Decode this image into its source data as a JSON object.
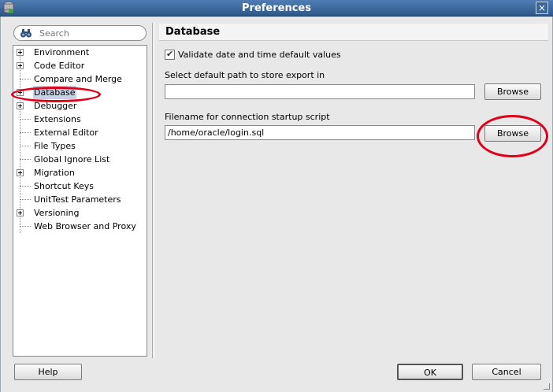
{
  "window": {
    "title": "Preferences",
    "close_glyph": "×",
    "app_icon": "oracle-sqldeveloper-icon"
  },
  "search": {
    "placeholder": "Search",
    "icon": "binoculars-icon"
  },
  "tree": {
    "items": [
      {
        "label": "Environment",
        "expandable": true,
        "selected": false
      },
      {
        "label": "Code Editor",
        "expandable": true,
        "selected": false
      },
      {
        "label": "Compare and Merge",
        "expandable": false,
        "selected": false
      },
      {
        "label": "Database",
        "expandable": true,
        "selected": true
      },
      {
        "label": "Debugger",
        "expandable": true,
        "selected": false
      },
      {
        "label": "Extensions",
        "expandable": false,
        "selected": false
      },
      {
        "label": "External Editor",
        "expandable": false,
        "selected": false
      },
      {
        "label": "File Types",
        "expandable": false,
        "selected": false
      },
      {
        "label": "Global Ignore List",
        "expandable": false,
        "selected": false
      },
      {
        "label": "Migration",
        "expandable": true,
        "selected": false
      },
      {
        "label": "Shortcut Keys",
        "expandable": false,
        "selected": false
      },
      {
        "label": "UnitTest Parameters",
        "expandable": false,
        "selected": false
      },
      {
        "label": "Versioning",
        "expandable": true,
        "selected": false
      },
      {
        "label": "Web Browser and Proxy",
        "expandable": false,
        "selected": false
      }
    ]
  },
  "panel": {
    "title": "Database",
    "validate_checkbox": {
      "label": "Validate date and time default values",
      "checked": true
    },
    "export_path": {
      "label": "Select default path to store export in",
      "value": ""
    },
    "startup_script": {
      "label": "Filename for connection startup script",
      "value": "/home/oracle/login.sql"
    },
    "browse_label": "Browse"
  },
  "footer": {
    "help_label": "Help",
    "ok_label": "OK",
    "cancel_label": "Cancel"
  },
  "colors": {
    "annotation": "#e0001a",
    "titlebar": "#3a6699",
    "selection": "#c6d3e6"
  }
}
